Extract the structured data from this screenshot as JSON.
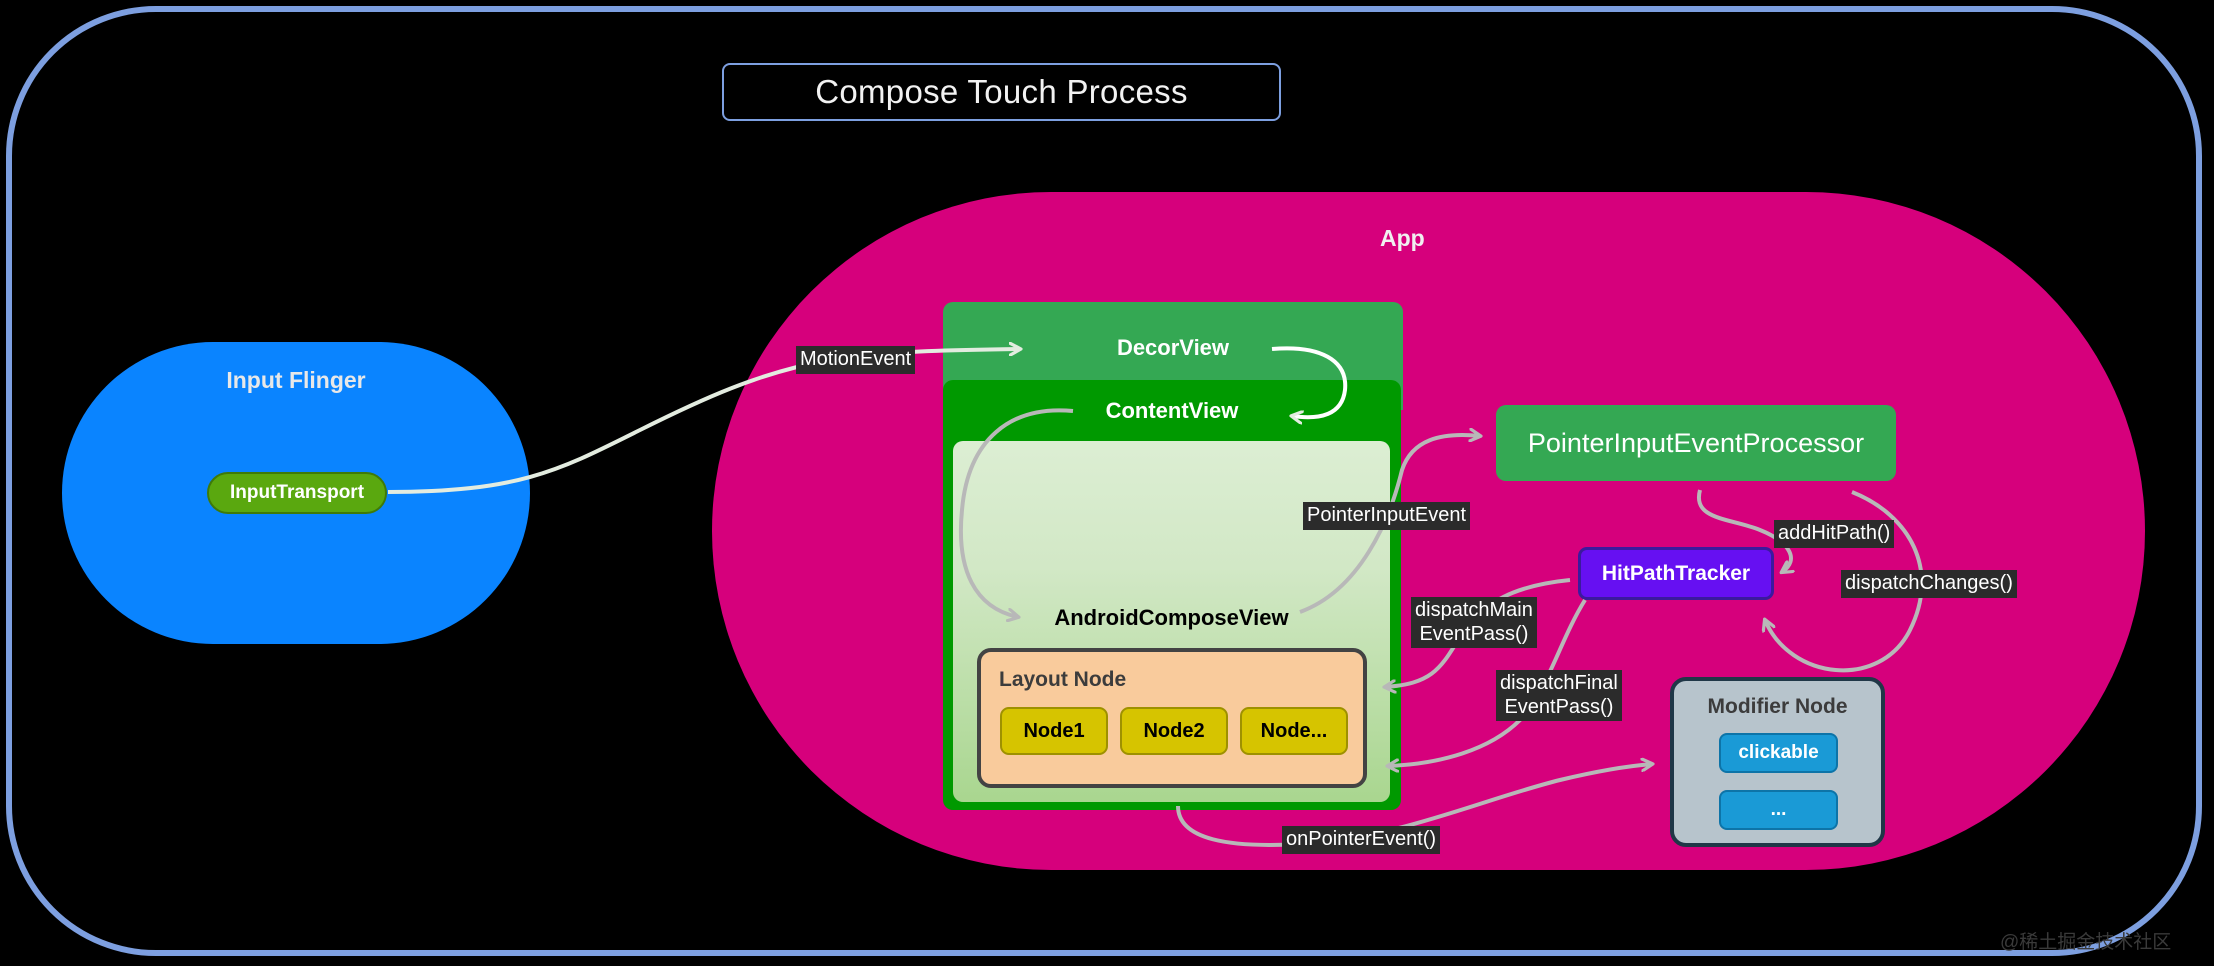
{
  "title": {
    "text": "Compose Touch Process"
  },
  "app": {
    "label": "App"
  },
  "input_flinger": {
    "label": "Input Flinger",
    "input_transport": "InputTransport"
  },
  "views": {
    "decor_view": "DecorView",
    "content_view": "ContentView",
    "compose_view": "AndroidComposeView"
  },
  "layout_node": {
    "title": "Layout Node",
    "nodes": [
      "Node1",
      "Node2",
      "Node..."
    ]
  },
  "processor": {
    "label": "PointerInputEventProcessor"
  },
  "hit_path_tracker": {
    "label": "HitPathTracker"
  },
  "modifier_node": {
    "title": "Modifier Node",
    "items": [
      "clickable",
      "..."
    ]
  },
  "edges": [
    {
      "id": "motion_event",
      "label": "MotionEvent"
    },
    {
      "id": "pointer_input_event",
      "label": "PointerInputEvent"
    },
    {
      "id": "dispatch_main",
      "label": "dispatchMain\nEventPass()"
    },
    {
      "id": "dispatch_final",
      "label": "dispatchFinal\nEventPass()"
    },
    {
      "id": "add_hit_path",
      "label": "addHitPath()"
    },
    {
      "id": "dispatch_changes",
      "label": "dispatchChanges()"
    },
    {
      "id": "on_pointer_event",
      "label": "onPointerEvent()"
    }
  ],
  "watermark": "@稀土掘金技术社区",
  "colors": {
    "background": "#000000",
    "frame_border": "#7d9fe0",
    "app_fill": "#d6007c",
    "flinger_fill": "#0a84ff",
    "input_transport_fill": "#5aa80f",
    "decor_view_fill": "#34a853",
    "content_view_fill": "#009900",
    "layout_node_fill": "#f9cb9c",
    "node_chip_fill": "#d6c400",
    "processor_fill": "#34a853",
    "hit_path_tracker_fill": "#6610f2",
    "modifier_node_fill": "#b7c4cc",
    "modifier_chip_fill": "#1a9ad6",
    "edge_stroke_light": "#e3ece0",
    "edge_stroke_gray": "#b8b8b8",
    "edge_label_bg": "#2b2b2b"
  }
}
